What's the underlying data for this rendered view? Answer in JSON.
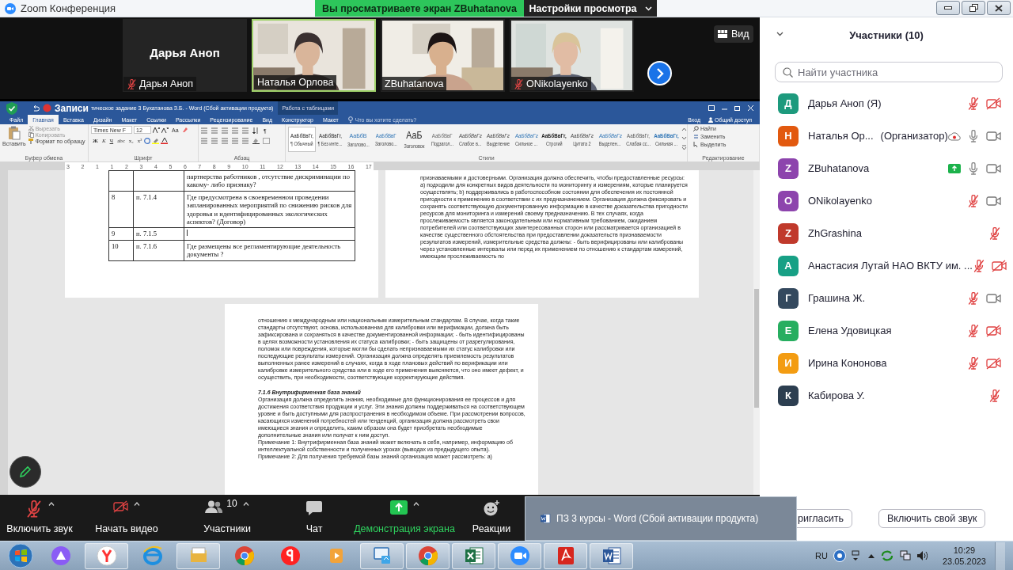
{
  "zoom_window": {
    "title": "Zoom Конференция",
    "share_banner": "Вы просматриваете экран ZBuhatanova",
    "view_settings": "Настройки просмотра"
  },
  "videos": [
    {
      "kind": "avatar",
      "name": "Дарья Аноп",
      "label": "Дарья Аноп",
      "muted": true,
      "speaking": false
    },
    {
      "kind": "video",
      "label": "Наталья Орлова",
      "muted": false,
      "speaking": true
    },
    {
      "kind": "video",
      "label": "ZBuhatanova",
      "muted": false,
      "speaking": false
    },
    {
      "kind": "video",
      "label": "ONikolayenko",
      "muted": true,
      "speaking": false
    }
  ],
  "view_button": "Вид",
  "word": {
    "recording_label": "Записи",
    "title": "тическое задание 3 Бухатанова З.Б. - Word (Сбой активации продукта)",
    "context_group": "Работа с таблицами",
    "tabs": [
      {
        "label": "Файл",
        "selected": false
      },
      {
        "label": "Главная",
        "selected": true
      },
      {
        "label": "Вставка",
        "selected": false
      },
      {
        "label": "Дизайн",
        "selected": false
      },
      {
        "label": "Макет",
        "selected": false
      },
      {
        "label": "Ссылки",
        "selected": false
      },
      {
        "label": "Рассылки",
        "selected": false
      },
      {
        "label": "Рецензирование",
        "selected": false
      },
      {
        "label": "Вид",
        "selected": false
      },
      {
        "label": "Конструктор",
        "selected": false
      },
      {
        "label": "Макет",
        "selected": false
      }
    ],
    "tell_me": "Что вы хотите сделать?",
    "sign_in": "Вход",
    "share": "Общий доступ",
    "clipboard": {
      "paste": "Вставить",
      "cut": "Вырезать",
      "copy": "Копировать",
      "format_painter": "Формат по образцу",
      "group": "Буфер обмена"
    },
    "font": {
      "name": "Times New F",
      "size": "12",
      "case": "Aa",
      "buttons": [
        "Ж",
        "К",
        "Ч",
        "abc",
        "x₂",
        "x²"
      ],
      "group": "Шрифт"
    },
    "paragraph": {
      "marks": "¶",
      "group": "Абзац"
    },
    "styles": {
      "group": "Стили",
      "items": [
        {
          "preview": "АаБбВвГг,",
          "name": "¶ Обычный",
          "kind": "normal",
          "selected": true
        },
        {
          "preview": "АаБбВвГг,",
          "name": "¶ Без инте...",
          "kind": "normal",
          "selected": false
        },
        {
          "preview": "АаБбВ",
          "name": "Заголово...",
          "kind": "heading1",
          "selected": false
        },
        {
          "preview": "АаБбВвГ",
          "name": "Заголово...",
          "kind": "heading2",
          "selected": false
        },
        {
          "preview": "АаБ",
          "name": "Заголовок",
          "kind": "title",
          "selected": false
        },
        {
          "preview": "АаБбВвГ",
          "name": "Подзагол...",
          "kind": "subtle",
          "selected": false
        },
        {
          "preview": "АаБбВвГг",
          "name": "Слабое в...",
          "kind": "emphasis",
          "selected": false
        },
        {
          "preview": "АаБбВвГг",
          "name": "Выделение",
          "kind": "emphasis",
          "selected": false
        },
        {
          "preview": "АаБбВвГг",
          "name": "Сильное ...",
          "kind": "accent",
          "selected": false
        },
        {
          "preview": "АаБбВвГг,",
          "name": "Строгий",
          "kind": "strong",
          "selected": false
        },
        {
          "preview": "АаБбВвГг",
          "name": "Цитата 2",
          "kind": "emphasis",
          "selected": false
        },
        {
          "preview": "АаБбВвГг",
          "name": "Выделен...",
          "kind": "accent",
          "selected": false
        },
        {
          "preview": "АаБбВвГг,",
          "name": "Слабая сс...",
          "kind": "caps",
          "selected": false
        },
        {
          "preview": "АаБбВвГг,",
          "name": "Сильная ...",
          "kind": "accentbold",
          "selected": false
        }
      ]
    },
    "editing": {
      "find": "Найти",
      "replace": "Заменить",
      "select": "Выделить",
      "group": "Редактирование"
    },
    "ruler": [
      "3",
      "2",
      "1",
      "1",
      "2",
      "3",
      "4",
      "5",
      "6",
      "7",
      "8",
      "9",
      "10",
      "11",
      "12",
      "13",
      "14",
      "15",
      "16",
      "17"
    ],
    "pages": [
      {
        "kind": "table",
        "rows": [
          {
            "text": "партнерства работников , отсутствие дискриминации по какому- либо признаку?"
          },
          {
            "number": "8",
            "clause": "п. 7.1.4",
            "text": "Где предусмотрена в своевременном проведении запланированных мероприятий по снижению рисков для здоровья и идентифицированных экологических аспектов? (Договор)"
          },
          {
            "number": "9",
            "clause": "п. 7.1.5"
          },
          {
            "number": "10",
            "clause": "п. 7.1.6",
            "text": "Где размещены все регламентирующие деятельность документы ?"
          }
        ]
      },
      {
        "kind": "text",
        "paragraphs": [
          {
            "kind": "body",
            "text": "признаваемыми и достоверными. Организация должна обеспечить, чтобы предоставленные ресурсы: а) подходили для конкретных видов деятельности по мониторингу и измерениям, которые планируется осуществлять; b) поддерживались в работоспособном состоянии для обеспечения их постоянной пригодности к применению в соответствии с их предназначением. Организация должна фиксировать и сохранять соответствующую документированную информацию в качестве доказательства пригодности ресурсов для мониторинга и измерений своему предназначению. В тех случаях, когда прослеживаемость является законодательным или нормативным требованием, ожиданием потребителей или соответствующих заинтересованных сторон или рассматривается организацией в качестве существенного обстоятельства при предоставлении доказательств признаваемости результатов измерений, измерительные средства должны: - быть верифицированы или калиброваны через установленные интервалы или перед их применением по отношению к стандартам измерений, имеющим прослеживаемость по"
          }
        ]
      },
      {
        "kind": "text",
        "paragraphs": [
          {
            "kind": "body",
            "text": "отношению к международным или национальным измерительным стандартам. В случае, когда такие стандарты отсутствуют, основа, использованная для калибровки или верификации, должна быть зафиксирована и сохраняться в качестве документированной информации; - быть идентифицированы в целях возможности установления их статуса калибровки; - быть защищены от разрегулирования, поломок или повреждения, которые могли бы сделать непризнаваемыми их статус калибровки или последующие результаты измерений. Организация должна определять приемлемость результатов выполненных ранее измерений в случаях, когда в ходе плановых действий по верификации или калибровке измерительного средства или в ходе его применения выясняется, что оно имеет дефект, и осуществить, при необходимости, соответствующие корректирующие действия."
          },
          {
            "kind": "heading",
            "text": "7.1.6 Внутрифирменная база знаний"
          },
          {
            "kind": "body",
            "text": "Организация должна определить знания, необходимые для функционирования ее процессов и для достижения соответствия продукции и услуг. Эти знания должны поддерживаться на соответствующем уровне и быть доступными для распространения в необходимом объеме. При рассмотрении вопросов, касающихся изменений потребностей или тенденций, организация должна рассмотреть свои имеющиеся знания и определить, каким образом она будет приобретать необходимые дополнительные знания или получат к ним доступ."
          },
          {
            "kind": "body",
            "text": "Примечание 1: Внутрифирменная база знаний может включать в себя, например, информацию об интеллектуальной собственности и полученных уроках (выводах из предыдущего опыта)."
          },
          {
            "kind": "body",
            "text": "Примечание 2: Для получения требуемой базы знаний организация может рассмотреть: а)"
          }
        ]
      }
    ]
  },
  "participants_panel": {
    "title": "Участники (10)",
    "search": {
      "placeholder": "Найти участника"
    },
    "participants": [
      {
        "initial": "Д",
        "color": "#1d9a7d",
        "name": "Дарья Аноп (Я)",
        "recording": false,
        "sharing": false,
        "muted": true,
        "camera": true,
        "video_off": true
      },
      {
        "initial": "Н",
        "color": "#e2590f",
        "name": "Наталья Ор...",
        "role": "(Организатор)",
        "recording": true,
        "sharing": false,
        "muted": false,
        "camera": true,
        "video_off": false
      },
      {
        "initial": "Z",
        "color": "#8d44ad",
        "name": "ZBuhatanova",
        "recording": false,
        "sharing": true,
        "muted": false,
        "camera": true,
        "video_off": false
      },
      {
        "initial": "O",
        "color": "#8d44ad",
        "name": "ONikolayenko",
        "recording": false,
        "sharing": false,
        "muted": true,
        "camera": true,
        "video_off": false
      },
      {
        "initial": "Z",
        "color": "#c0392b",
        "name": "ZhGrashina",
        "recording": false,
        "sharing": false,
        "muted": true,
        "camera": false
      },
      {
        "initial": "А",
        "color": "#17a085",
        "name": "Анастасия Лутай НАО ВКТУ им. ...",
        "recording": false,
        "sharing": false,
        "muted": true,
        "camera": true,
        "video_off": true
      },
      {
        "initial": "Г",
        "color": "#34495e",
        "name": "Грашина Ж.",
        "recording": false,
        "sharing": false,
        "muted": true,
        "camera": true,
        "video_off": false
      },
      {
        "initial": "Е",
        "color": "#27ae60",
        "name": "Елена Удовицкая",
        "recording": false,
        "sharing": false,
        "muted": true,
        "camera": true,
        "video_off": true
      },
      {
        "initial": "И",
        "color": "#f39c12",
        "name": "Ирина Кононова",
        "recording": false,
        "sharing": false,
        "muted": true,
        "camera": true,
        "video_off": true
      },
      {
        "initial": "К",
        "color": "#2c3e50",
        "name": "Кабирова У.",
        "recording": false,
        "sharing": false,
        "muted": true,
        "camera": false
      }
    ]
  },
  "toolbar": {
    "items": [
      {
        "kind": "mic_muted",
        "label": "Включить звук",
        "caret": true,
        "highlighted": false
      },
      {
        "kind": "video_off",
        "label": "Начать видео",
        "caret": true,
        "highlighted": false
      },
      {
        "kind": "participants",
        "label": "Участники",
        "count": "10",
        "caret": true,
        "highlighted": false
      },
      {
        "kind": "chat",
        "label": "Чат",
        "caret": false,
        "highlighted": false
      },
      {
        "kind": "share",
        "label": "Демонстрация экрана",
        "caret": true,
        "highlighted": true
      },
      {
        "kind": "reactions",
        "label": "Реакции",
        "caret": false,
        "highlighted": false
      }
    ],
    "panel_buttons": [
      "ригласить",
      "Включить свой звук"
    ]
  },
  "taskbar": {
    "preview": "ПЗ 3 курсы - Word (Сбой активации продукта)",
    "apps": [
      {
        "kind": "alice",
        "running": false
      },
      {
        "kind": "ybrowser",
        "running": true
      },
      {
        "kind": "ie",
        "running": false
      },
      {
        "kind": "explorer",
        "running": true
      },
      {
        "kind": "chrome",
        "running": false
      },
      {
        "kind": "yandex",
        "running": false
      },
      {
        "kind": "media",
        "running": false
      },
      {
        "kind": "remote",
        "running": true
      },
      {
        "kind": "chrome",
        "running": true
      },
      {
        "kind": "excel",
        "running": true
      },
      {
        "kind": "zoom",
        "running": true
      },
      {
        "kind": "acrobat",
        "running": true
      },
      {
        "kind": "word",
        "running": true
      }
    ],
    "language": "RU",
    "time": "10:29",
    "date": "23.05.2023"
  }
}
